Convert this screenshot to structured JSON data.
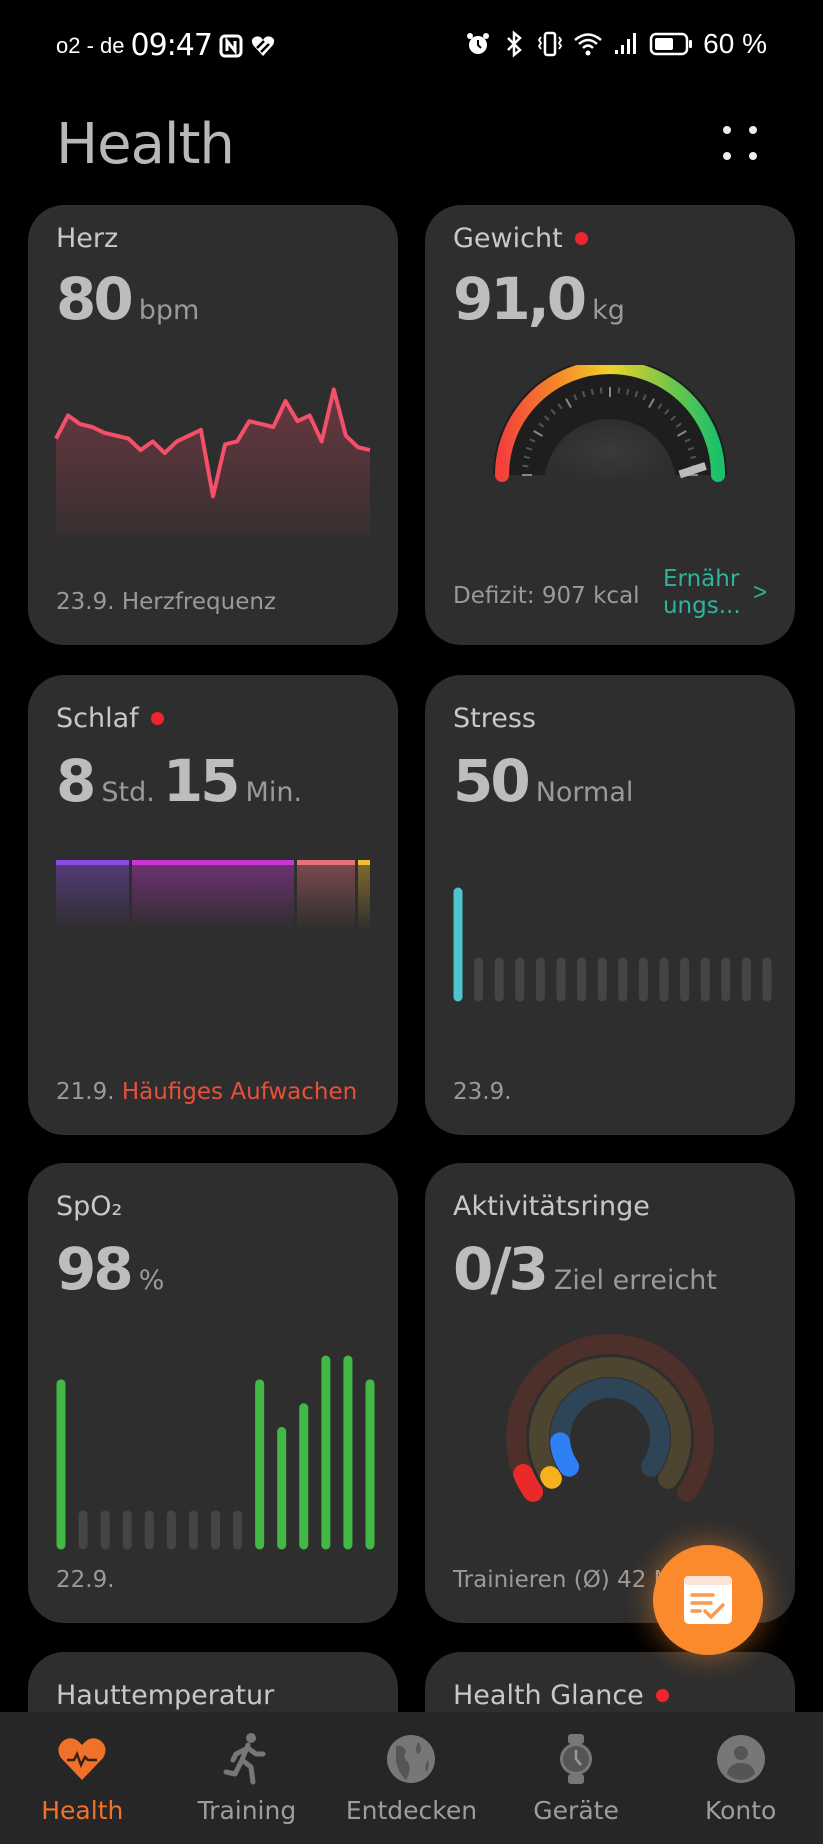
{
  "status_bar": {
    "carrier": "o2 - de",
    "time": "09:47",
    "left_icons": [
      "nfc-icon",
      "health-app-icon"
    ],
    "right_icons": [
      "alarm-icon",
      "bluetooth-icon",
      "vibrate-icon",
      "wifi-icon",
      "signal-icon",
      "battery-icon"
    ],
    "battery_text": "60 %",
    "battery_level": 0.6
  },
  "header": {
    "title": "Health",
    "menu_icon": "grid-dots-icon"
  },
  "cards": {
    "heart": {
      "title": "Herz",
      "value": "80",
      "unit": "bpm",
      "footer_date": "23.9.",
      "footer_text": "Herzfrequenz",
      "color": "#f4506a",
      "series": [
        78,
        86,
        83,
        82,
        80,
        79,
        78,
        74,
        77,
        73,
        77,
        79,
        81,
        58,
        76,
        77,
        84,
        83,
        82,
        91,
        84,
        86,
        77,
        95,
        79,
        75,
        74
      ]
    },
    "weight": {
      "title": "Gewicht",
      "has_badge": true,
      "value": "91,0",
      "unit": "kg",
      "footer_text": "Defizit: 907 kcal",
      "link_text": "Ernähr ungs...",
      "link_chevron": ">",
      "gauge_position": 0.97,
      "gauge_colors": [
        "#f2413b",
        "#f5862a",
        "#f0d22a",
        "#7ec745",
        "#1ac16a"
      ]
    },
    "sleep": {
      "title": "Schlaf",
      "has_badge": true,
      "hours": "8",
      "hours_unit": "Std.",
      "minutes": "15",
      "minutes_unit": "Min.",
      "footer_date": "21.9.",
      "footer_alert": "Häufiges Aufwachen",
      "segments": [
        {
          "name": "deep",
          "fraction": 0.24,
          "color": "#8a4ce0"
        },
        {
          "name": "light",
          "fraction": 0.53,
          "color": "#c936d6"
        },
        {
          "name": "rem",
          "fraction": 0.19,
          "color": "#e8717a"
        },
        {
          "name": "awake",
          "fraction": 0.04,
          "color": "#f0c030"
        }
      ]
    },
    "stress": {
      "title": "Stress",
      "value": "50",
      "label": "Normal",
      "footer_date": "23.9.",
      "bars": [
        50,
        0,
        0,
        0,
        0,
        0,
        0,
        0,
        0,
        0,
        0,
        0,
        0,
        0,
        0,
        0
      ],
      "active_color": "#4fc4cc"
    },
    "spo2": {
      "title": "SpO₂",
      "value": "98",
      "unit": "%",
      "footer_date": "22.9.",
      "bars": [
        96,
        0,
        0,
        0,
        0,
        0,
        0,
        0,
        0,
        96,
        92,
        94,
        98,
        98,
        96
      ],
      "active_color": "#42b944"
    },
    "activity": {
      "title": "Aktivitätsringe",
      "value": "0/3",
      "label": "Ziel erreicht",
      "footer_text": "Trainieren (Ø) 42 Mi",
      "rings": [
        {
          "name": "move",
          "progress": 0.05,
          "color": "#ea2a2a",
          "track": "#4c3029"
        },
        {
          "name": "exercise",
          "progress": 0.01,
          "color": "#f5b21e",
          "track": "#4d4530"
        },
        {
          "name": "stand",
          "progress": 0.12,
          "color": "#2f7ff5",
          "track": "#2e4558"
        }
      ]
    },
    "skin_temp": {
      "title": "Hauttemperatur"
    },
    "health_glance": {
      "title": "Health Glance",
      "has_badge": true
    }
  },
  "fab": {
    "icon": "checklist-icon"
  },
  "bottom_nav": {
    "items": [
      {
        "label": "Health",
        "icon": "heart-pulse-icon",
        "active": true
      },
      {
        "label": "Training",
        "icon": "running-icon",
        "active": false
      },
      {
        "label": "Entdecken",
        "icon": "globe-icon",
        "active": false
      },
      {
        "label": "Geräte",
        "icon": "watch-icon",
        "active": false
      },
      {
        "label": "Konto",
        "icon": "account-icon",
        "active": false
      }
    ],
    "active_color": "#f0712b"
  }
}
